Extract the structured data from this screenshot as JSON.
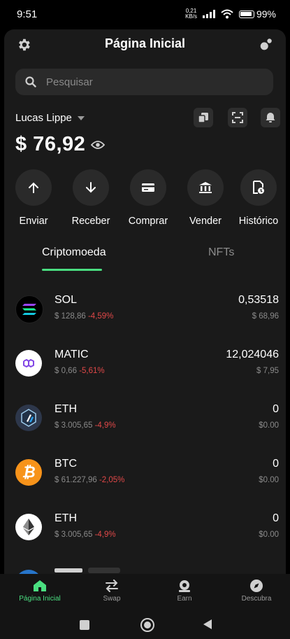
{
  "status": {
    "time": "9:51",
    "kbs_top": "0,21",
    "kbs_bottom": "KB/s",
    "battery": "99%"
  },
  "header": {
    "title": "Página Inicial"
  },
  "search": {
    "placeholder": "Pesquisar"
  },
  "account": {
    "name": "Lucas Lippe",
    "balance": "$ 76,92"
  },
  "actions": [
    {
      "label": "Enviar"
    },
    {
      "label": "Receber"
    },
    {
      "label": "Comprar"
    },
    {
      "label": "Vender"
    },
    {
      "label": "Histórico"
    }
  ],
  "tabs": [
    {
      "label": "Criptomoeda"
    },
    {
      "label": "NFTs"
    }
  ],
  "assets": [
    {
      "symbol": "SOL",
      "price": "$ 128,86",
      "change": "-4,59%",
      "quantity": "0,53518",
      "value": "$ 68,96"
    },
    {
      "symbol": "MATIC",
      "price": "$ 0,66",
      "change": "-5,61%",
      "quantity": "12,024046",
      "value": "$ 7,95"
    },
    {
      "symbol": "ETH",
      "price": "$ 3.005,65",
      "change": "-4,9%",
      "quantity": "0",
      "value": "$0.00"
    },
    {
      "symbol": "BTC",
      "price": "$ 61.227,96",
      "change": "-2,05%",
      "quantity": "0",
      "value": "$0.00"
    },
    {
      "symbol": "ETH",
      "price": "$ 3.005,65",
      "change": "-4,9%",
      "quantity": "0",
      "value": "$0.00"
    }
  ],
  "bottom_nav": [
    {
      "label": "Página Inicial",
      "active": true
    },
    {
      "label": "Swap"
    },
    {
      "label": "Earn"
    },
    {
      "label": "Descubra"
    }
  ],
  "colors": {
    "accent": "#4ade80",
    "negative": "#e04848",
    "background": "#1a1a1a"
  }
}
